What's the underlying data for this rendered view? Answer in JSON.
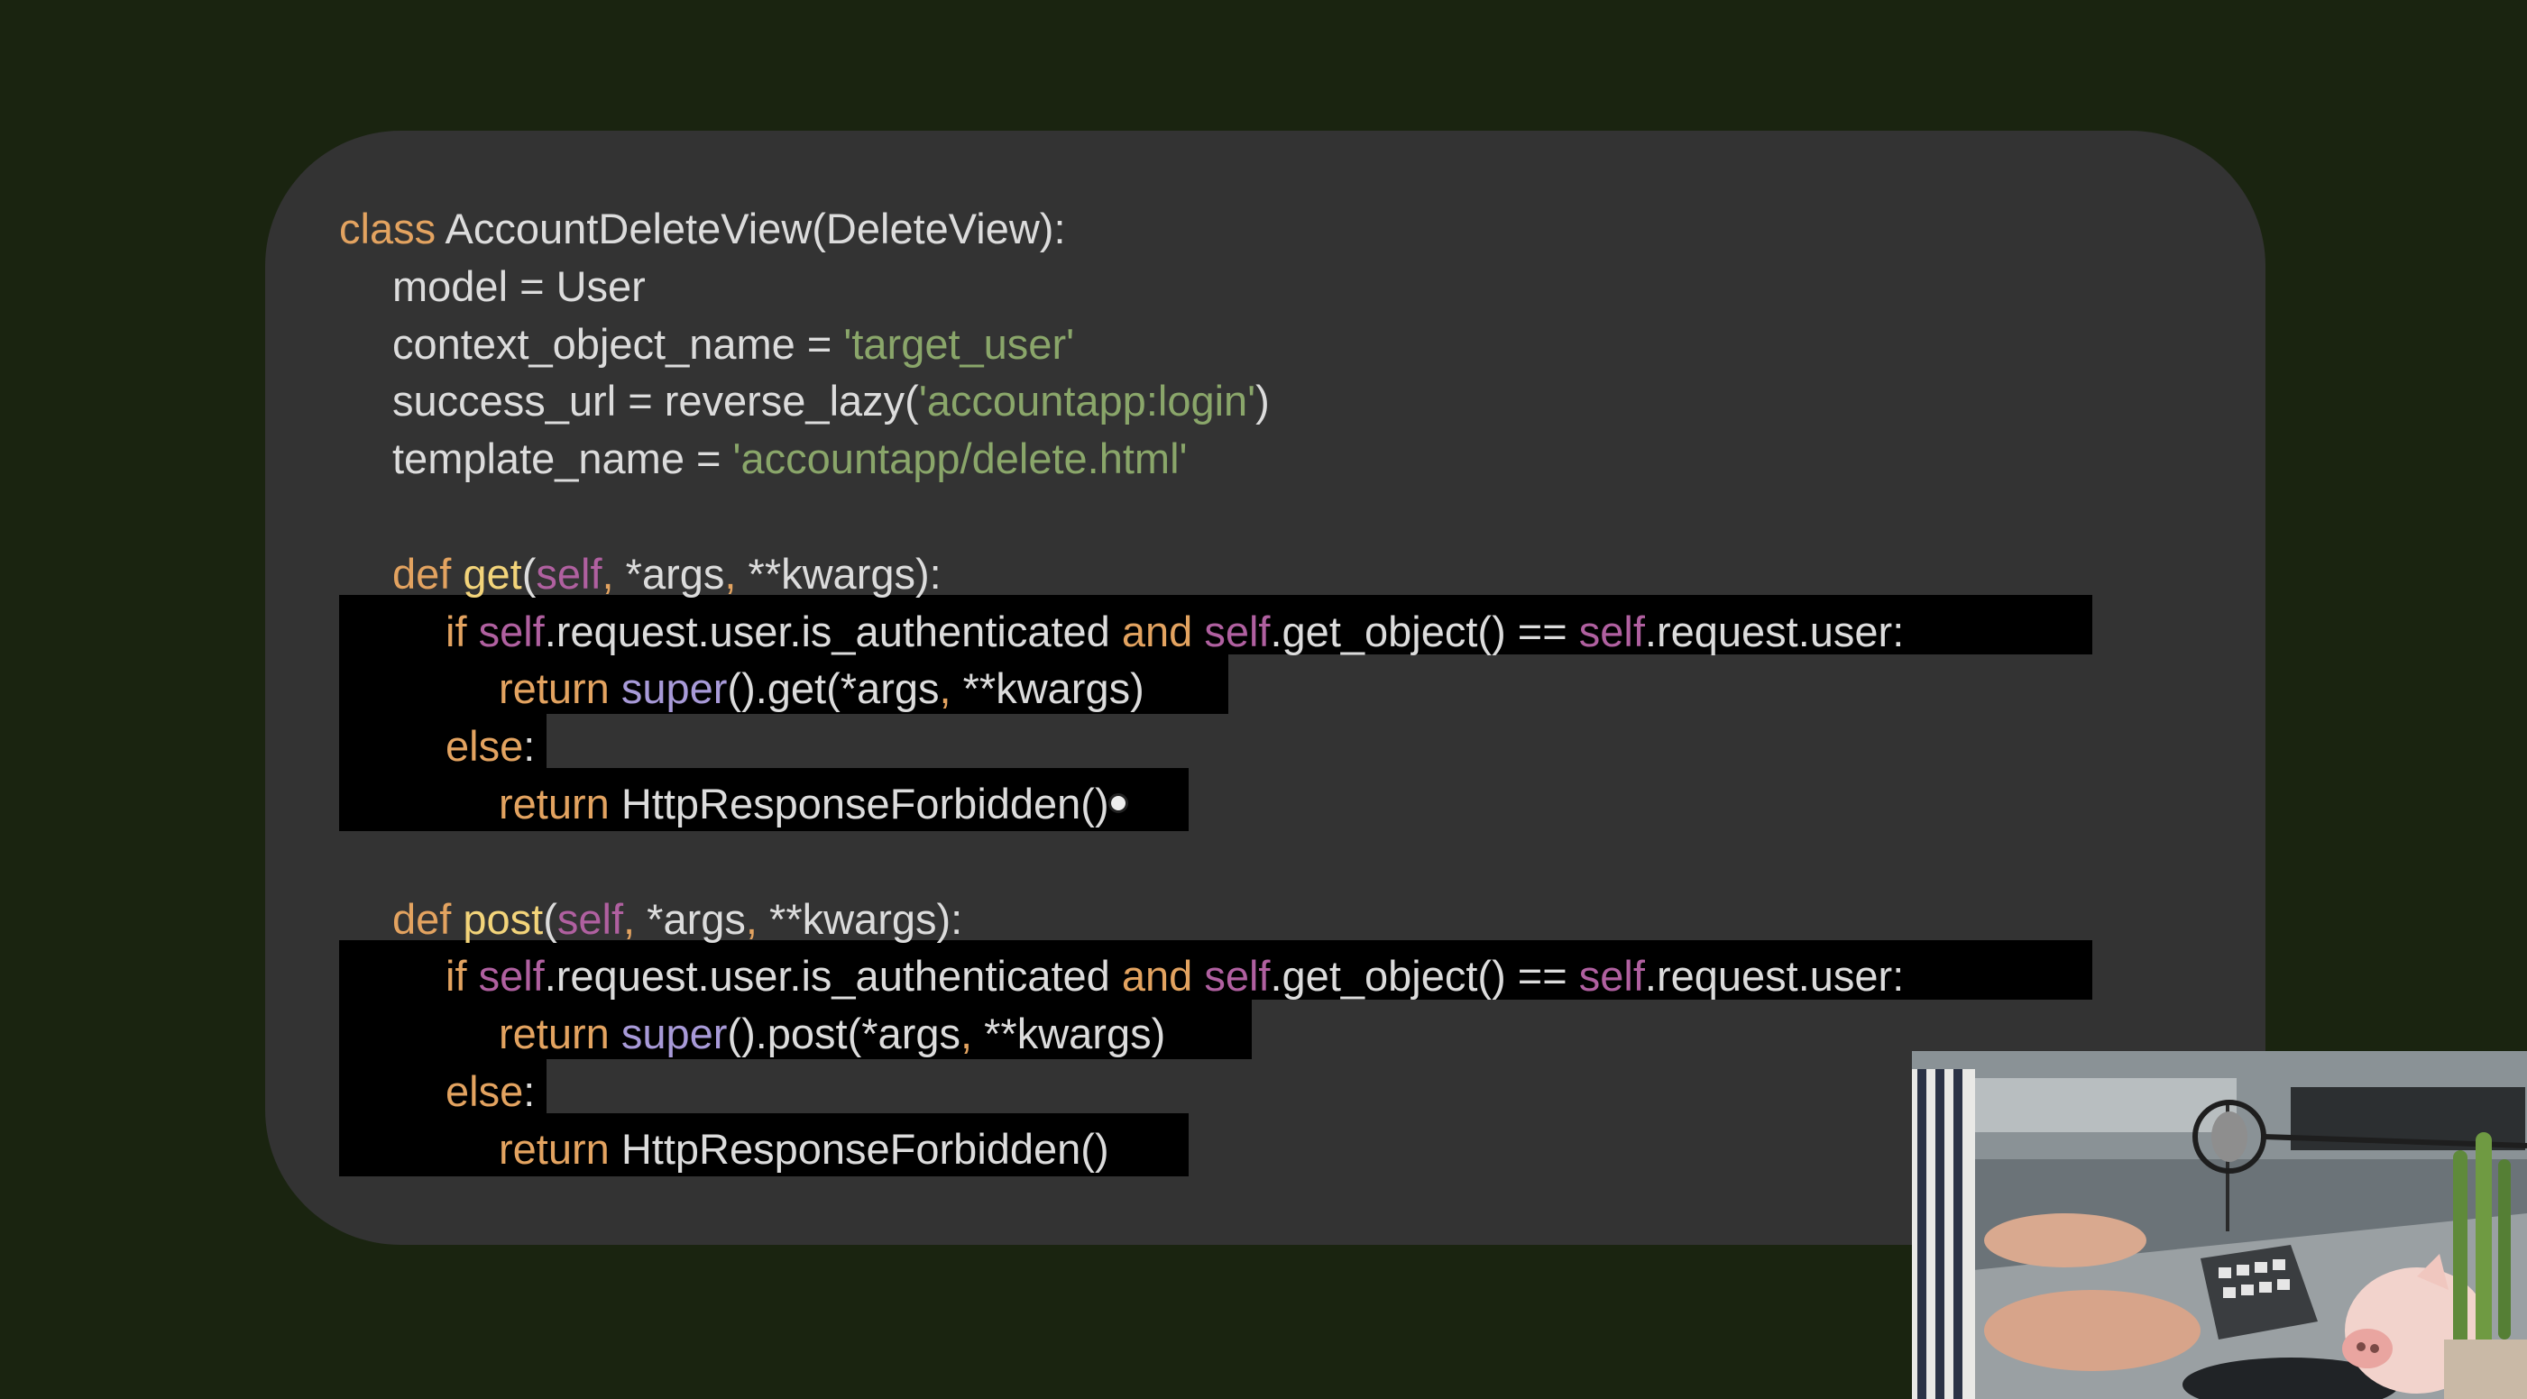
{
  "code": {
    "lines": [
      [
        {
          "t": "class",
          "c": "kw"
        },
        {
          "t": " AccountDeleteView(DeleteView):",
          "c": ""
        }
      ],
      [
        {
          "t": "model = User",
          "c": ""
        }
      ],
      [
        {
          "t": "context_object_name = ",
          "c": ""
        },
        {
          "t": "'target_user'",
          "c": "str"
        }
      ],
      [
        {
          "t": "success_url = reverse_lazy(",
          "c": ""
        },
        {
          "t": "'accountapp:login'",
          "c": "str"
        },
        {
          "t": ")",
          "c": ""
        }
      ],
      [
        {
          "t": "template_name = ",
          "c": ""
        },
        {
          "t": "'accountapp/delete.html'",
          "c": "str"
        }
      ],
      [],
      [
        {
          "t": "def",
          "c": "kw"
        },
        {
          "t": " ",
          "c": ""
        },
        {
          "t": "get",
          "c": "fn"
        },
        {
          "t": "(",
          "c": ""
        },
        {
          "t": "self",
          "c": "self"
        },
        {
          "t": ", ",
          "c": "punct"
        },
        {
          "t": "*args",
          "c": ""
        },
        {
          "t": ", ",
          "c": "punct"
        },
        {
          "t": "**kwargs):",
          "c": ""
        }
      ],
      [
        {
          "t": "if",
          "c": "kw"
        },
        {
          "t": " ",
          "c": ""
        },
        {
          "t": "self",
          "c": "self"
        },
        {
          "t": ".request.user.is_authenticated ",
          "c": ""
        },
        {
          "t": "and",
          "c": "kw"
        },
        {
          "t": " ",
          "c": ""
        },
        {
          "t": "self",
          "c": "self"
        },
        {
          "t": ".get_object() == ",
          "c": ""
        },
        {
          "t": "self",
          "c": "self"
        },
        {
          "t": ".request.user:",
          "c": ""
        }
      ],
      [
        {
          "t": "return",
          "c": "kw"
        },
        {
          "t": " ",
          "c": ""
        },
        {
          "t": "super",
          "c": "bi"
        },
        {
          "t": "().get(*args",
          "c": ""
        },
        {
          "t": ", ",
          "c": "punct"
        },
        {
          "t": "**kwargs)",
          "c": ""
        }
      ],
      [
        {
          "t": "else",
          "c": "kw"
        },
        {
          "t": ":",
          "c": ""
        }
      ],
      [
        {
          "t": "return",
          "c": "kw"
        },
        {
          "t": " HttpResponseForbidden()",
          "c": ""
        }
      ],
      [],
      [
        {
          "t": "def",
          "c": "kw"
        },
        {
          "t": " ",
          "c": ""
        },
        {
          "t": "post",
          "c": "fn"
        },
        {
          "t": "(",
          "c": ""
        },
        {
          "t": "self",
          "c": "self"
        },
        {
          "t": ", ",
          "c": "punct"
        },
        {
          "t": "*args",
          "c": ""
        },
        {
          "t": ", ",
          "c": "punct"
        },
        {
          "t": "**kwargs):",
          "c": ""
        }
      ],
      [
        {
          "t": "if",
          "c": "kw"
        },
        {
          "t": " ",
          "c": ""
        },
        {
          "t": "self",
          "c": "self"
        },
        {
          "t": ".request.user.is_authenticated ",
          "c": ""
        },
        {
          "t": "and",
          "c": "kw"
        },
        {
          "t": " ",
          "c": ""
        },
        {
          "t": "self",
          "c": "self"
        },
        {
          "t": ".get_object() == ",
          "c": ""
        },
        {
          "t": "self",
          "c": "self"
        },
        {
          "t": ".request.user:",
          "c": ""
        }
      ],
      [
        {
          "t": "return",
          "c": "kw"
        },
        {
          "t": " ",
          "c": ""
        },
        {
          "t": "super",
          "c": "bi"
        },
        {
          "t": "().post(*args",
          "c": ""
        },
        {
          "t": ", ",
          "c": "punct"
        },
        {
          "t": "**kwargs)",
          "c": ""
        }
      ],
      [
        {
          "t": "else",
          "c": "kw"
        },
        {
          "t": ":",
          "c": ""
        }
      ],
      [
        {
          "t": "return",
          "c": "kw"
        },
        {
          "t": " HttpResponseForbidden()",
          "c": ""
        }
      ]
    ],
    "indent": [
      0,
      1,
      1,
      1,
      1,
      0,
      1,
      2,
      3,
      2,
      3,
      0,
      1,
      2,
      3,
      2,
      3
    ]
  },
  "colors": {
    "background": "#1a2410",
    "card": "#333333",
    "keyword": "#e3a360",
    "function": "#f3d47a",
    "self": "#b060a0",
    "string": "#8aa66a",
    "builtin": "#a89ad8",
    "selection": "#000000"
  }
}
